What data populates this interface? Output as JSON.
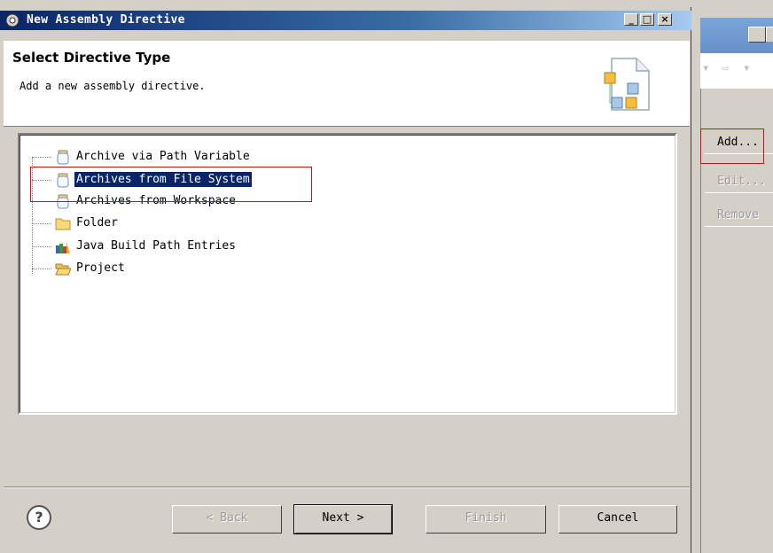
{
  "dialog": {
    "title": "New Assembly Directive",
    "header_title": "Select Directive Type",
    "header_description": "Add a new assembly directive.",
    "title_buttons": [
      "_",
      "□",
      "×"
    ]
  },
  "tree": {
    "items": [
      {
        "label": "Archive via Path Variable",
        "icon": "jar-icon",
        "selected": false
      },
      {
        "label": "Archives from File System",
        "icon": "jar-icon",
        "selected": true
      },
      {
        "label": "Archives from Workspace",
        "icon": "jar-icon",
        "selected": false
      },
      {
        "label": "Folder",
        "icon": "folder-icon",
        "selected": false
      },
      {
        "label": "Java Build Path Entries",
        "icon": "library-icon",
        "selected": false
      },
      {
        "label": "Project",
        "icon": "open-folder-icon",
        "selected": false
      }
    ]
  },
  "buttons": {
    "help": "?",
    "back": "< Back",
    "next": "Next >",
    "finish": "Finish",
    "cancel": "Cancel"
  },
  "background_window": {
    "buttons": [
      {
        "label": "Add...",
        "enabled": true
      },
      {
        "label": "Edit...",
        "enabled": false
      },
      {
        "label": "Remove",
        "enabled": false
      }
    ]
  },
  "colors": {
    "selection": "#0a246a",
    "highlight_box": "#d01010",
    "title_gradient_start": "#0a246a"
  }
}
